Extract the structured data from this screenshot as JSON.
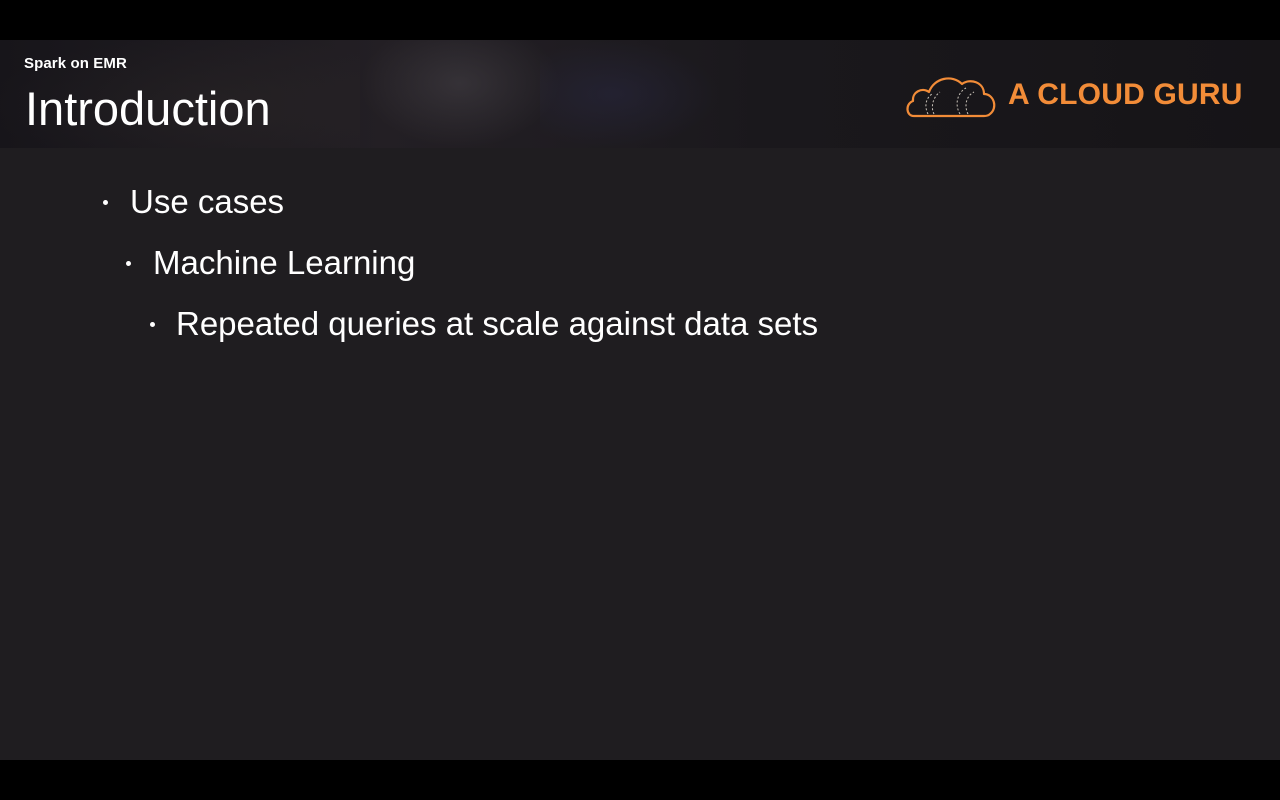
{
  "slide": {
    "course": "Spark on EMR",
    "title": "Introduction"
  },
  "brand": {
    "name": "A CLOUD GURU",
    "logo_icon": "cloud-logo-icon",
    "color": "#f28c38"
  },
  "bullets": [
    {
      "level": 1,
      "text": "Use cases"
    },
    {
      "level": 2,
      "text": "Machine Learning"
    },
    {
      "level": 3,
      "text": "Repeated queries at scale against data sets"
    }
  ],
  "colors": {
    "slide_background": "#1f1d20",
    "text": "#ffffff",
    "letterbox": "#000000"
  }
}
